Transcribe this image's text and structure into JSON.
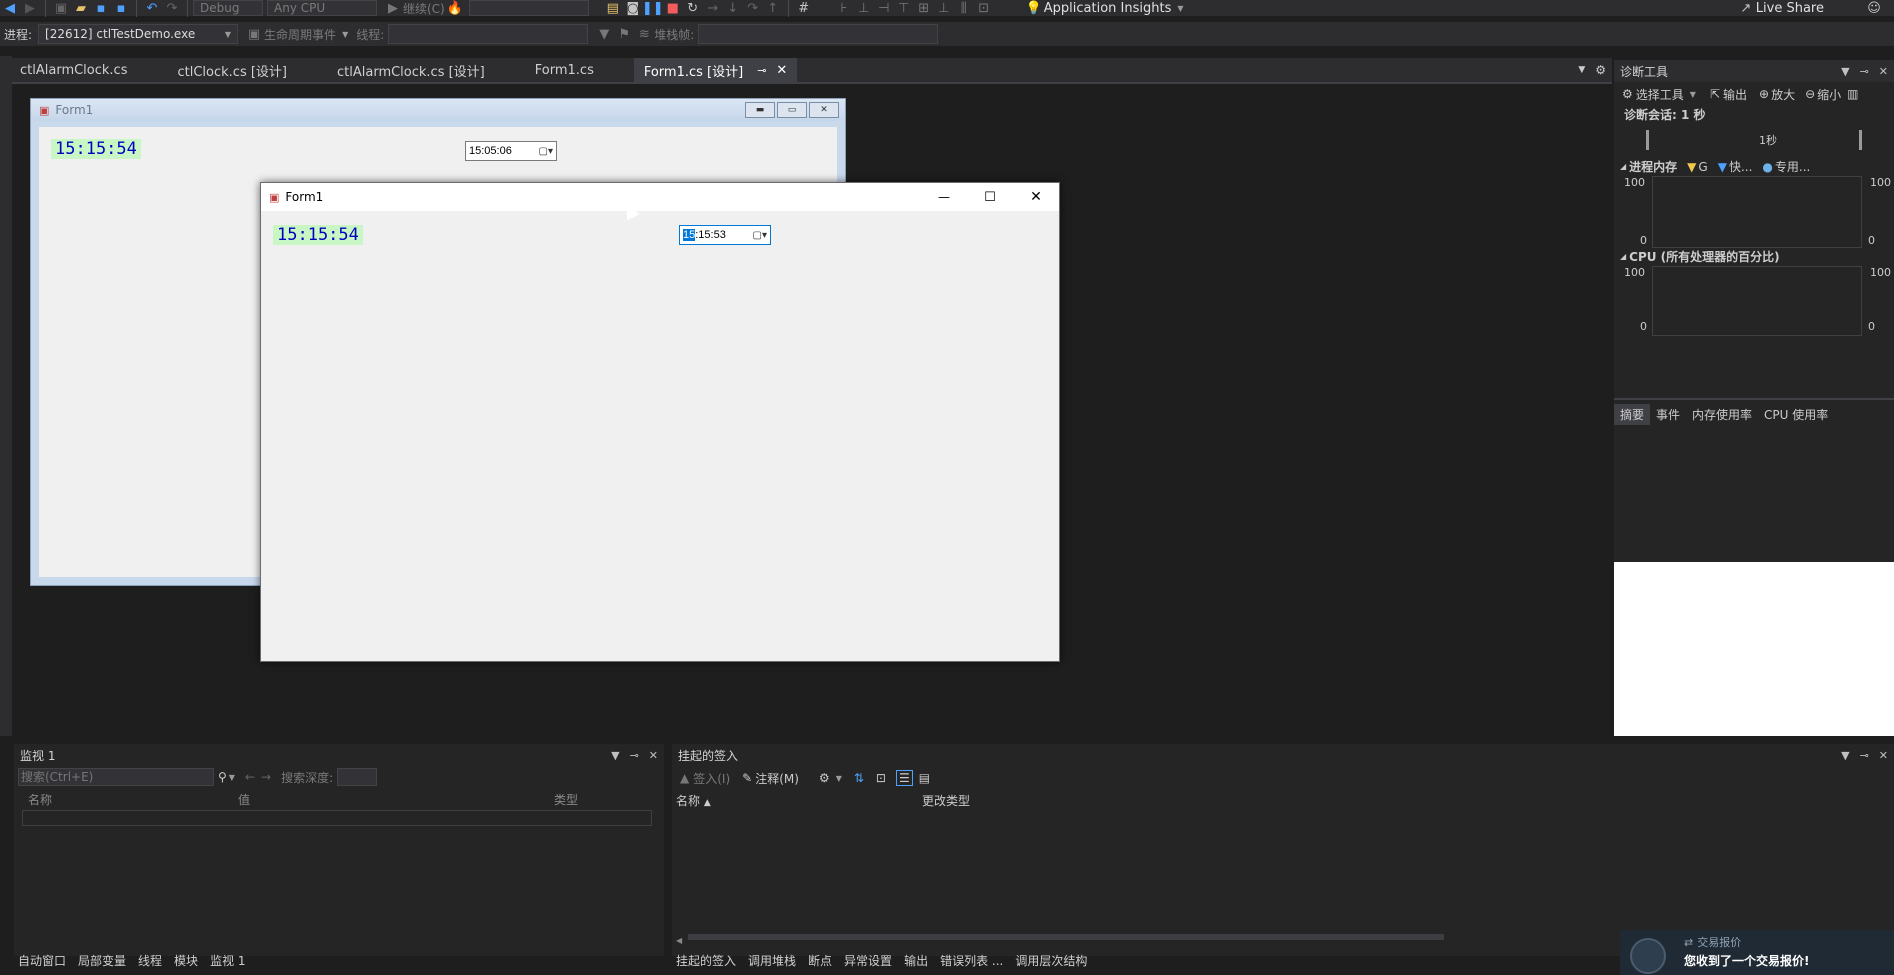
{
  "toolbar1": {
    "config": "Debug",
    "platform": "Any CPU",
    "continue": "继续(C)",
    "app_insights": "Application Insights",
    "live_share": "Live Share"
  },
  "toolbar2": {
    "process_label": "进程:",
    "process_value": "[22612] ctlTestDemo.exe",
    "lifecycle": "生命周期事件",
    "thread_label": "线程:",
    "stack_label": "堆栈帧:"
  },
  "tabs": [
    {
      "label": "ctlAlarmClock.cs"
    },
    {
      "label": "ctlClock.cs [设计]"
    },
    {
      "label": "ctlAlarmClock.cs [设计]"
    },
    {
      "label": "Form1.cs"
    },
    {
      "label": "Form1.cs [设计]"
    }
  ],
  "design_form": {
    "title": "Form1",
    "clock": "15:15:54",
    "picker": "15:05:06"
  },
  "runtime_form": {
    "title": "Form1",
    "clock": "15:15:54",
    "picker_sel": "15",
    "picker_rest": ":15:53"
  },
  "diag": {
    "title": "诊断工具",
    "select_tools": "选择工具",
    "output": "输出",
    "zoom_in": "放大",
    "zoom_out": "缩小",
    "session": "诊断会话: 1 秒",
    "timeline": "1秒",
    "memory_title": "进程内存",
    "legend_g": "G",
    "legend_fast": "快...",
    "legend_private": "专用...",
    "cpu_title": "CPU (所有处理器的百分比)",
    "y_max": "100",
    "y_min": "0",
    "tabs": [
      "摘要",
      "事件",
      "内存使用率",
      "CPU 使用率"
    ]
  },
  "watch": {
    "title": "监视 1",
    "search_placeholder": "搜索(Ctrl+E)",
    "search_depth": "搜索深度:",
    "col_name": "名称",
    "col_value": "值",
    "col_type": "类型",
    "bottom_tabs": [
      "自动窗口",
      "局部变量",
      "线程",
      "模块",
      "监视 1"
    ]
  },
  "pending": {
    "title": "挂起的签入",
    "checkin": "签入(I)",
    "comment": "注释(M)",
    "col_name": "名称",
    "col_change": "更改类型",
    "bottom_tabs": [
      "挂起的签入",
      "调用堆栈",
      "断点",
      "异常设置",
      "输出",
      "错误列表 ...",
      "调用层次结构"
    ]
  },
  "toast": {
    "title": "交易报价",
    "message": "您收到了一个交易报价!"
  },
  "colors": {
    "ide_bg": "#1e1e1e",
    "accent": "#007acc",
    "clock_bg": "#c8f7c5"
  }
}
